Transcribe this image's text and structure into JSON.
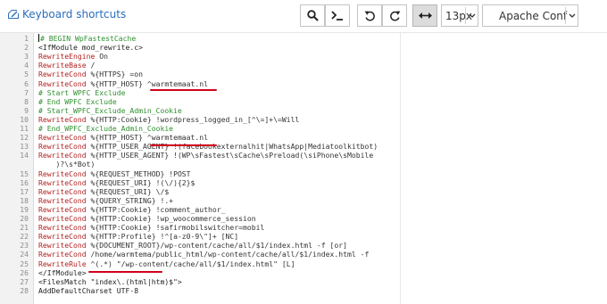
{
  "toolbar": {
    "shortcuts_label": "Keyboard shortcuts",
    "font_size": "13px",
    "mode": "Apache Conf"
  },
  "editor": {
    "lines": [
      {
        "n": "1",
        "parts": [
          {
            "t": "# BEGIN WpFastestCache",
            "c": "c"
          }
        ]
      },
      {
        "n": "2",
        "parts": [
          {
            "t": "<IfModule mod_rewrite.c>",
            "c": "t"
          }
        ]
      },
      {
        "n": "3",
        "parts": [
          {
            "t": "RewriteEngine",
            "c": "k"
          },
          {
            "t": " On",
            "c": "v"
          }
        ]
      },
      {
        "n": "4",
        "parts": [
          {
            "t": "RewriteBase",
            "c": "k"
          },
          {
            "t": " /",
            "c": "v"
          }
        ]
      },
      {
        "n": "5",
        "parts": [
          {
            "t": "RewriteCond",
            "c": "k"
          },
          {
            "t": " %{HTTPS} =on",
            "c": "v"
          }
        ]
      },
      {
        "n": "6",
        "parts": [
          {
            "t": "RewriteCond",
            "c": "k"
          },
          {
            "t": " %{HTTP_HOST} ^warmtemaat.nl",
            "c": "v"
          }
        ]
      },
      {
        "n": "7",
        "parts": [
          {
            "t": "# Start WPFC Exclude",
            "c": "c"
          }
        ]
      },
      {
        "n": "8",
        "parts": [
          {
            "t": "# End WPFC Exclude",
            "c": "c"
          }
        ]
      },
      {
        "n": "9",
        "parts": [
          {
            "t": "# Start_WPFC_Exclude_Admin_Cookie",
            "c": "c"
          }
        ]
      },
      {
        "n": "10",
        "parts": [
          {
            "t": "RewriteCond",
            "c": "k"
          },
          {
            "t": " %{HTTP:Cookie} !wordpress_logged_in_[^\\=]+\\=Will",
            "c": "v"
          }
        ]
      },
      {
        "n": "11",
        "parts": [
          {
            "t": "# End_WPFC_Exclude_Admin_Cookie",
            "c": "c"
          }
        ]
      },
      {
        "n": "12",
        "parts": [
          {
            "t": "RewriteCond",
            "c": "k"
          },
          {
            "t": " %{HTTP_HOST} ^warmtemaat.nl",
            "c": "v"
          }
        ]
      },
      {
        "n": "13",
        "parts": [
          {
            "t": "RewriteCond",
            "c": "k"
          },
          {
            "t": " %{HTTP_USER_AGENT} !(facebookexternalhit|WhatsApp|Mediatoolkitbot)",
            "c": "v"
          }
        ]
      },
      {
        "n": "14",
        "parts": [
          {
            "t": "RewriteCond",
            "c": "k"
          },
          {
            "t": " %{HTTP_USER_AGENT} !(WP\\sFastest\\sCache\\sPreload(\\siPhone\\sMobile",
            "c": "v"
          }
        ]
      },
      {
        "n": "",
        "parts": [
          {
            "t": "    )?\\s*Bot)",
            "c": "v"
          }
        ]
      },
      {
        "n": "15",
        "parts": [
          {
            "t": "RewriteCond",
            "c": "k"
          },
          {
            "t": " %{REQUEST_METHOD} !POST",
            "c": "v"
          }
        ]
      },
      {
        "n": "16",
        "parts": [
          {
            "t": "RewriteCond",
            "c": "k"
          },
          {
            "t": " %{REQUEST_URI} !(\\/){2}$",
            "c": "v"
          }
        ]
      },
      {
        "n": "17",
        "parts": [
          {
            "t": "RewriteCond",
            "c": "k"
          },
          {
            "t": " %{REQUEST_URI} \\/$",
            "c": "v"
          }
        ]
      },
      {
        "n": "18",
        "parts": [
          {
            "t": "RewriteCond",
            "c": "k"
          },
          {
            "t": " %{QUERY_STRING} !.+",
            "c": "v"
          }
        ]
      },
      {
        "n": "19",
        "parts": [
          {
            "t": "RewriteCond",
            "c": "k"
          },
          {
            "t": " %{HTTP:Cookie} !comment_author_",
            "c": "v"
          }
        ]
      },
      {
        "n": "20",
        "parts": [
          {
            "t": "RewriteCond",
            "c": "k"
          },
          {
            "t": " %{HTTP:Cookie} !wp_woocommerce_session",
            "c": "v"
          }
        ]
      },
      {
        "n": "21",
        "parts": [
          {
            "t": "RewriteCond",
            "c": "k"
          },
          {
            "t": " %{HTTP:Cookie} !safirmobilswitcher=mobil",
            "c": "v"
          }
        ]
      },
      {
        "n": "22",
        "parts": [
          {
            "t": "RewriteCond",
            "c": "k"
          },
          {
            "t": " %{HTTP:Profile} !^[a-z0-9\\\"]+ [NC]",
            "c": "v"
          }
        ]
      },
      {
        "n": "23",
        "parts": [
          {
            "t": "RewriteCond",
            "c": "k"
          },
          {
            "t": " %{DOCUMENT_ROOT}/wp-content/cache/all/$1/index.html -f [or]",
            "c": "v"
          }
        ]
      },
      {
        "n": "24",
        "parts": [
          {
            "t": "RewriteCond",
            "c": "k"
          },
          {
            "t": " /home/warmtema/public_html/wp-content/cache/all/$1/index.html -f",
            "c": "v"
          }
        ]
      },
      {
        "n": "25",
        "parts": [
          {
            "t": "RewriteRule",
            "c": "k"
          },
          {
            "t": " ^(.*) \"/wp-content/cache/all/$1/index.html\" [L]",
            "c": "v"
          }
        ]
      },
      {
        "n": "26",
        "parts": [
          {
            "t": "</IfModule>",
            "c": "t"
          }
        ]
      },
      {
        "n": "27",
        "parts": [
          {
            "t": "<FilesMatch \"index\\.(html|htm)$\">",
            "c": "t"
          }
        ]
      },
      {
        "n": "28",
        "parts": [
          {
            "t": "AddDefaultCharset UTF-8",
            "c": "t"
          }
        ]
      }
    ]
  },
  "colors": {
    "keyword": "#b22222",
    "comment": "#2f8f2f",
    "link": "#2a6ebb",
    "annotation": "#d0021b"
  },
  "icons": [
    "keyboard-icon",
    "search-icon",
    "terminal-icon",
    "undo-icon",
    "redo-icon",
    "wrap-icon",
    "chevron-down-icon"
  ]
}
